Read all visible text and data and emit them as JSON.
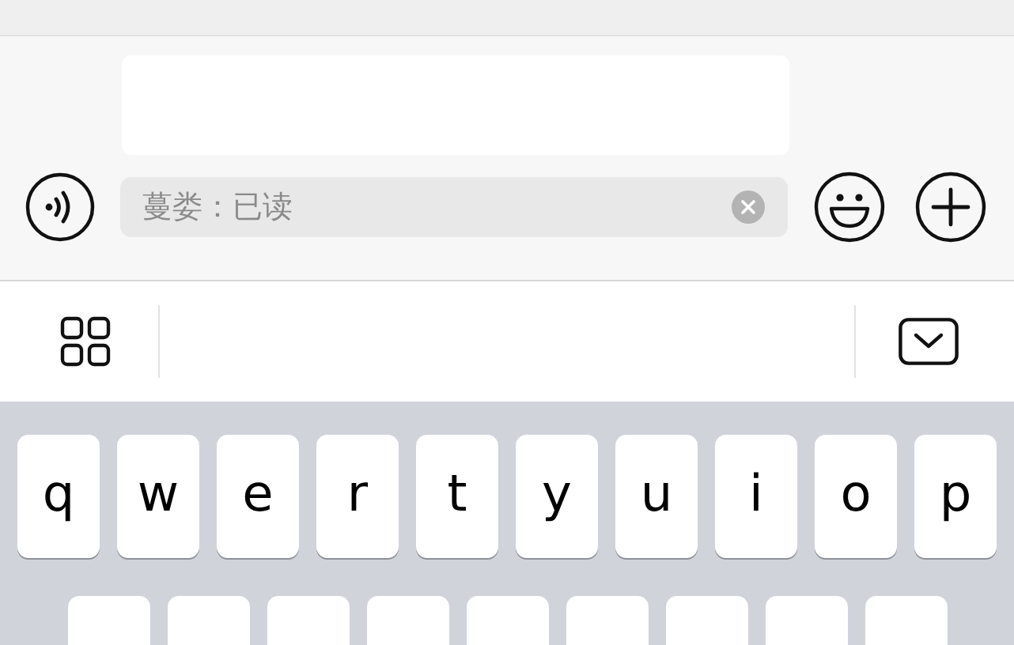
{
  "input_bar": {
    "placeholder": "蔓娄：已读"
  },
  "keyboard": {
    "rows": [
      {
        "keys": [
          "q",
          "w",
          "e",
          "r",
          "t",
          "y",
          "u",
          "i",
          "o",
          "p"
        ]
      }
    ]
  }
}
